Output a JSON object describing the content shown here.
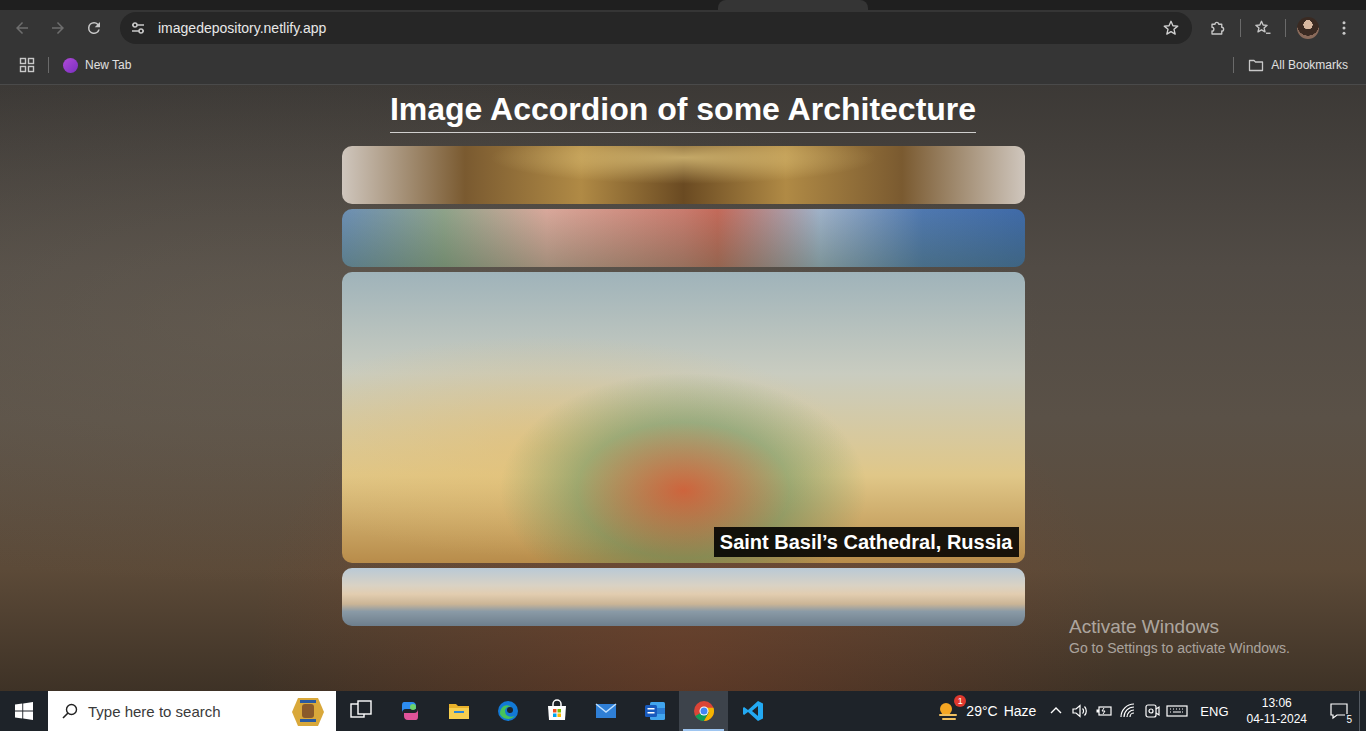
{
  "browser": {
    "url": "imagedepository.netlify.app",
    "back_enabled": false,
    "forward_enabled": false,
    "bookmarks": [
      {
        "label": "New Tab"
      }
    ],
    "all_bookmarks": "All Bookmarks"
  },
  "page": {
    "title": "Image Accordion of some Architecture",
    "panels": [
      {
        "expanded": false
      },
      {
        "expanded": false
      },
      {
        "expanded": true,
        "caption": "Saint Basil’s Cathedral, Russia"
      },
      {
        "expanded": false
      }
    ]
  },
  "watermark": {
    "title": "Activate Windows",
    "subtitle": "Go to Settings to activate Windows."
  },
  "taskbar": {
    "search_placeholder": "Type here to search",
    "apps": [
      {
        "selected": false
      },
      {
        "selected": false
      },
      {
        "selected": false
      },
      {
        "selected": false
      },
      {
        "selected": false
      },
      {
        "selected": false
      },
      {
        "selected": false
      },
      {
        "selected": true
      },
      {
        "selected": false
      }
    ],
    "weather": {
      "badge": "1",
      "temperature": "29°C",
      "condition": "Haze"
    },
    "language": "ENG",
    "time": "13:06",
    "date": "04-11-2024",
    "notifications": "5"
  }
}
